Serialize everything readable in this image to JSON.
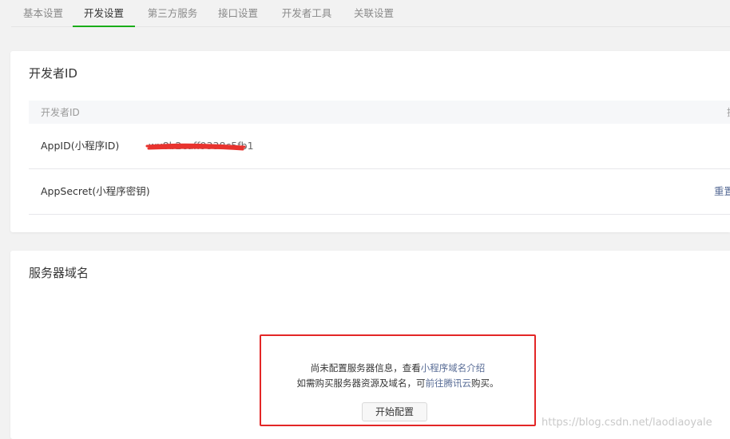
{
  "tabs": [
    {
      "label": "基本设置",
      "active": false
    },
    {
      "label": "开发设置",
      "active": true
    },
    {
      "label": "第三方服务",
      "active": false
    },
    {
      "label": "接口设置",
      "active": false
    },
    {
      "label": "开发者工具",
      "active": false
    },
    {
      "label": "关联设置",
      "active": false
    }
  ],
  "developer_id": {
    "title": "开发者ID",
    "table_header": "开发者ID",
    "table_header_right": "操",
    "rows": [
      {
        "label": "AppID(小程序ID)",
        "value": "wx8b2caff9338c5fb1",
        "redacted": true
      },
      {
        "label": "AppSecret(小程序密钥)",
        "action": "重置"
      }
    ]
  },
  "server_domain": {
    "title": "服务器域名",
    "notice": {
      "line1_prefix": "尚未配置服务器信息，查看",
      "line1_link": "小程序域名介绍",
      "line2_prefix": "如需购买服务器资源及域名，可",
      "line2_link": "前往腾讯云",
      "line2_suffix": "购买。",
      "button_label": "开始配置"
    }
  },
  "watermark": "https://blog.csdn.net/laodiaoyale",
  "colors": {
    "accent": "#1aad19",
    "link": "#576b95",
    "highlight_border": "#e32626",
    "redaction": "#e8332e"
  }
}
